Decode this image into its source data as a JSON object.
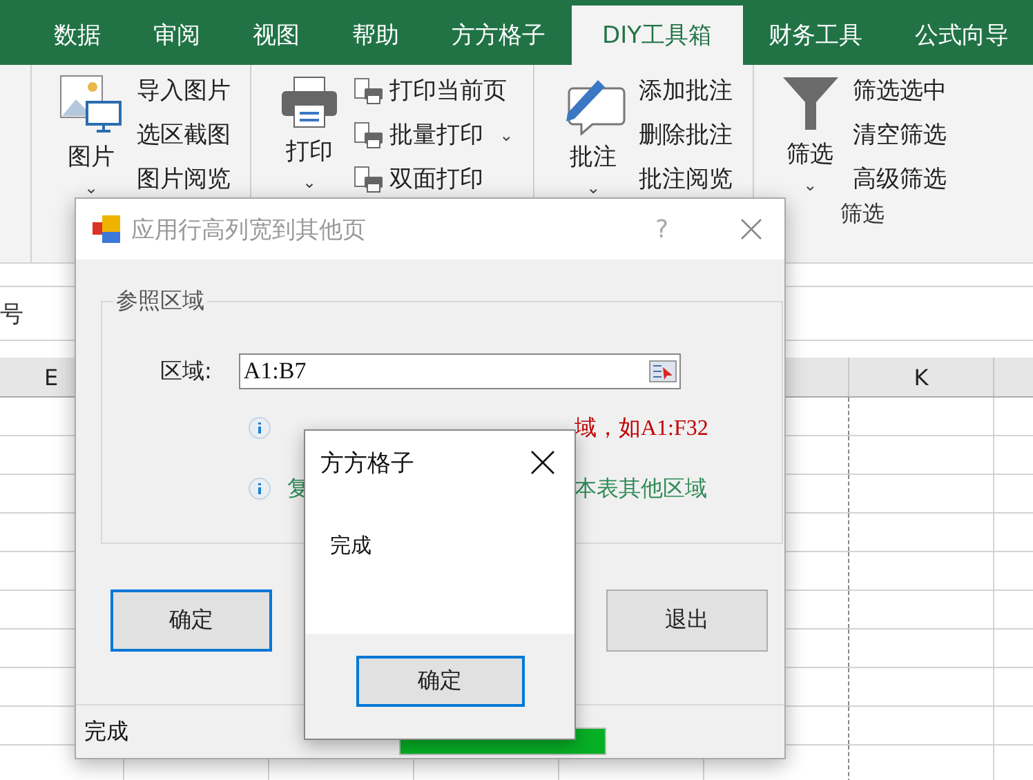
{
  "ribbon_tabs": [
    {
      "label": "数据",
      "selected": false
    },
    {
      "label": "审阅",
      "selected": false
    },
    {
      "label": "视图",
      "selected": false
    },
    {
      "label": "帮助",
      "selected": false
    },
    {
      "label": "方方格子",
      "selected": false
    },
    {
      "label": "DIY工具箱",
      "selected": true
    },
    {
      "label": "财务工具",
      "selected": false
    },
    {
      "label": "公式向导",
      "selected": false
    }
  ],
  "ribbon_groups": [
    {
      "kind": "picture",
      "big": {
        "label": "图片",
        "caret": "⌄"
      },
      "items": [
        {
          "label": "导入图片"
        },
        {
          "label": "选区截图"
        },
        {
          "label": "图片阅览"
        }
      ]
    },
    {
      "kind": "print",
      "big": {
        "label": "打印",
        "caret": "⌄"
      },
      "items": [
        {
          "label": "打印当前页"
        },
        {
          "label": "批量打印",
          "caret": "⌄"
        },
        {
          "label": "双面打印"
        }
      ]
    },
    {
      "kind": "comment",
      "big": {
        "label": "批注",
        "caret": "⌄"
      },
      "items": [
        {
          "label": "添加批注"
        },
        {
          "label": "删除批注"
        },
        {
          "label": "批注阅览"
        }
      ]
    },
    {
      "kind": "filter",
      "big": {
        "label": "筛选",
        "caret": "⌄"
      },
      "items": [
        {
          "label": "筛选选中"
        },
        {
          "label": "清空筛选"
        },
        {
          "label": "高级筛选"
        }
      ],
      "group_label": "筛选"
    }
  ],
  "name_box": "号",
  "column_headers": [
    "E",
    "K"
  ],
  "dialog": {
    "title": "应用行高列宽到其他页",
    "help": "?",
    "group_title": "参照区域",
    "range_label": "区域:",
    "range_value": "A1:B7",
    "hints": [
      {
        "right": "域，如A1:F32",
        "color": "#c00000"
      },
      {
        "left": "复",
        "right": "本表其他区域",
        "color": "#2e8b57"
      }
    ],
    "buttons": [
      {
        "label": "确定",
        "focused": true
      },
      {
        "label": "退出",
        "focused": false
      }
    ],
    "status": "完成",
    "progress": {
      "level": 1
    }
  },
  "message_box": {
    "title": "方方格子",
    "message": "完成",
    "button": {
      "label": "确定",
      "focused": true
    }
  }
}
